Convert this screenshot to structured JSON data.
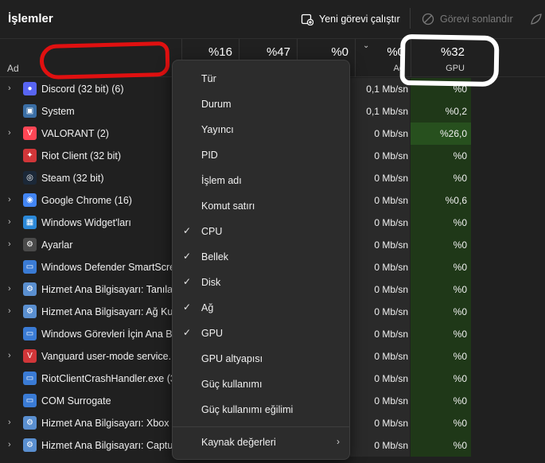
{
  "titlebar": {
    "title": "İşlemler",
    "run_task": "Yeni görevi çalıştır",
    "end_task": "Görevi sonlandır",
    "efficiency_icon": "leaf-icon"
  },
  "header": {
    "name_col": "Ad",
    "columns": [
      {
        "pct": "%16",
        "sub": ""
      },
      {
        "pct": "%47",
        "sub": ""
      },
      {
        "pct": "%0",
        "sub": ""
      },
      {
        "pct": "%0",
        "sub": "Ağ"
      },
      {
        "pct": "%32",
        "sub": "GPU"
      }
    ]
  },
  "processes": [
    {
      "name": "Discord (32 bit) (6)",
      "net": "0,1 Mb/sn",
      "gpu": "%0",
      "icon": "discord-icon",
      "color": "#5865f2"
    },
    {
      "name": "System",
      "net": "0,1 Mb/sn",
      "gpu": "%0,2",
      "icon": "system-icon",
      "color": "#3a6ea5"
    },
    {
      "name": "VALORANT (2)",
      "net": "0 Mb/sn",
      "gpu": "%26,0",
      "icon": "valorant-icon",
      "color": "#ff4655"
    },
    {
      "name": "Riot Client (32 bit)",
      "net": "0 Mb/sn",
      "gpu": "%0",
      "icon": "riot-icon",
      "color": "#d13639"
    },
    {
      "name": "Steam (32 bit)",
      "net": "0 Mb/sn",
      "gpu": "%0",
      "icon": "steam-icon",
      "color": "#1b2838"
    },
    {
      "name": "Google Chrome (16)",
      "net": "0 Mb/sn",
      "gpu": "%0,6",
      "icon": "chrome-icon",
      "color": "#4285f4"
    },
    {
      "name": "Windows Widget'ları",
      "net": "0 Mb/sn",
      "gpu": "%0",
      "icon": "widgets-icon",
      "color": "#2b88d8"
    },
    {
      "name": "Ayarlar",
      "net": "0 Mb/sn",
      "gpu": "%0",
      "icon": "settings-icon",
      "color": "#4a4a4a"
    },
    {
      "name": "Windows Defender SmartScreen",
      "net": "0 Mb/sn",
      "gpu": "%0",
      "icon": "window-icon",
      "color": "#3a7bd5"
    },
    {
      "name": "Hizmet Ana Bilgisayarı: Tanıla...",
      "net": "0 Mb/sn",
      "gpu": "%0",
      "icon": "service-gear-icon",
      "color": "#5a8fd0"
    },
    {
      "name": "Hizmet Ana Bilgisayarı: Ağ Kur...",
      "net": "0 Mb/sn",
      "gpu": "%0",
      "icon": "service-gear-icon",
      "color": "#5a8fd0"
    },
    {
      "name": "Windows Görevleri İçin Ana Bi...",
      "net": "0 Mb/sn",
      "gpu": "%0",
      "icon": "window-icon",
      "color": "#3a7bd5"
    },
    {
      "name": "Vanguard user-mode service.",
      "net": "0 Mb/sn",
      "gpu": "%0",
      "icon": "vanguard-icon",
      "color": "#d13639"
    },
    {
      "name": "RiotClientCrashHandler.exe (3...",
      "net": "0 Mb/sn",
      "gpu": "%0",
      "icon": "window-icon",
      "color": "#3a7bd5"
    },
    {
      "name": "COM Surrogate",
      "net": "0 Mb/sn",
      "gpu": "%0",
      "icon": "window-icon",
      "color": "#3a7bd5"
    },
    {
      "name": "Hizmet Ana Bilgisayarı: Xbox L...",
      "net": "0 Mb/sn",
      "gpu": "%0",
      "icon": "service-gear-icon",
      "color": "#5a8fd0"
    },
    {
      "name": "Hizmet Ana Bilgisayarı: Captur...",
      "net": "0 Mb/sn",
      "gpu": "%0",
      "icon": "service-gear-icon",
      "color": "#5a8fd0"
    }
  ],
  "context_menu": {
    "items": [
      {
        "label": "Tür",
        "checked": false
      },
      {
        "label": "Durum",
        "checked": false
      },
      {
        "label": "Yayıncı",
        "checked": false
      },
      {
        "label": "PID",
        "checked": false
      },
      {
        "label": "İşlem adı",
        "checked": false
      },
      {
        "label": "Komut satırı",
        "checked": false
      },
      {
        "label": "CPU",
        "checked": true
      },
      {
        "label": "Bellek",
        "checked": true
      },
      {
        "label": "Disk",
        "checked": true
      },
      {
        "label": "Ağ",
        "checked": true
      },
      {
        "label": "GPU",
        "checked": true
      },
      {
        "label": "GPU altyapısı",
        "checked": false
      },
      {
        "label": "Güç kullanımı",
        "checked": false
      },
      {
        "label": "Güç kullanımı eğilimi",
        "checked": false
      }
    ],
    "submenu_label": "Kaynak değerleri"
  }
}
